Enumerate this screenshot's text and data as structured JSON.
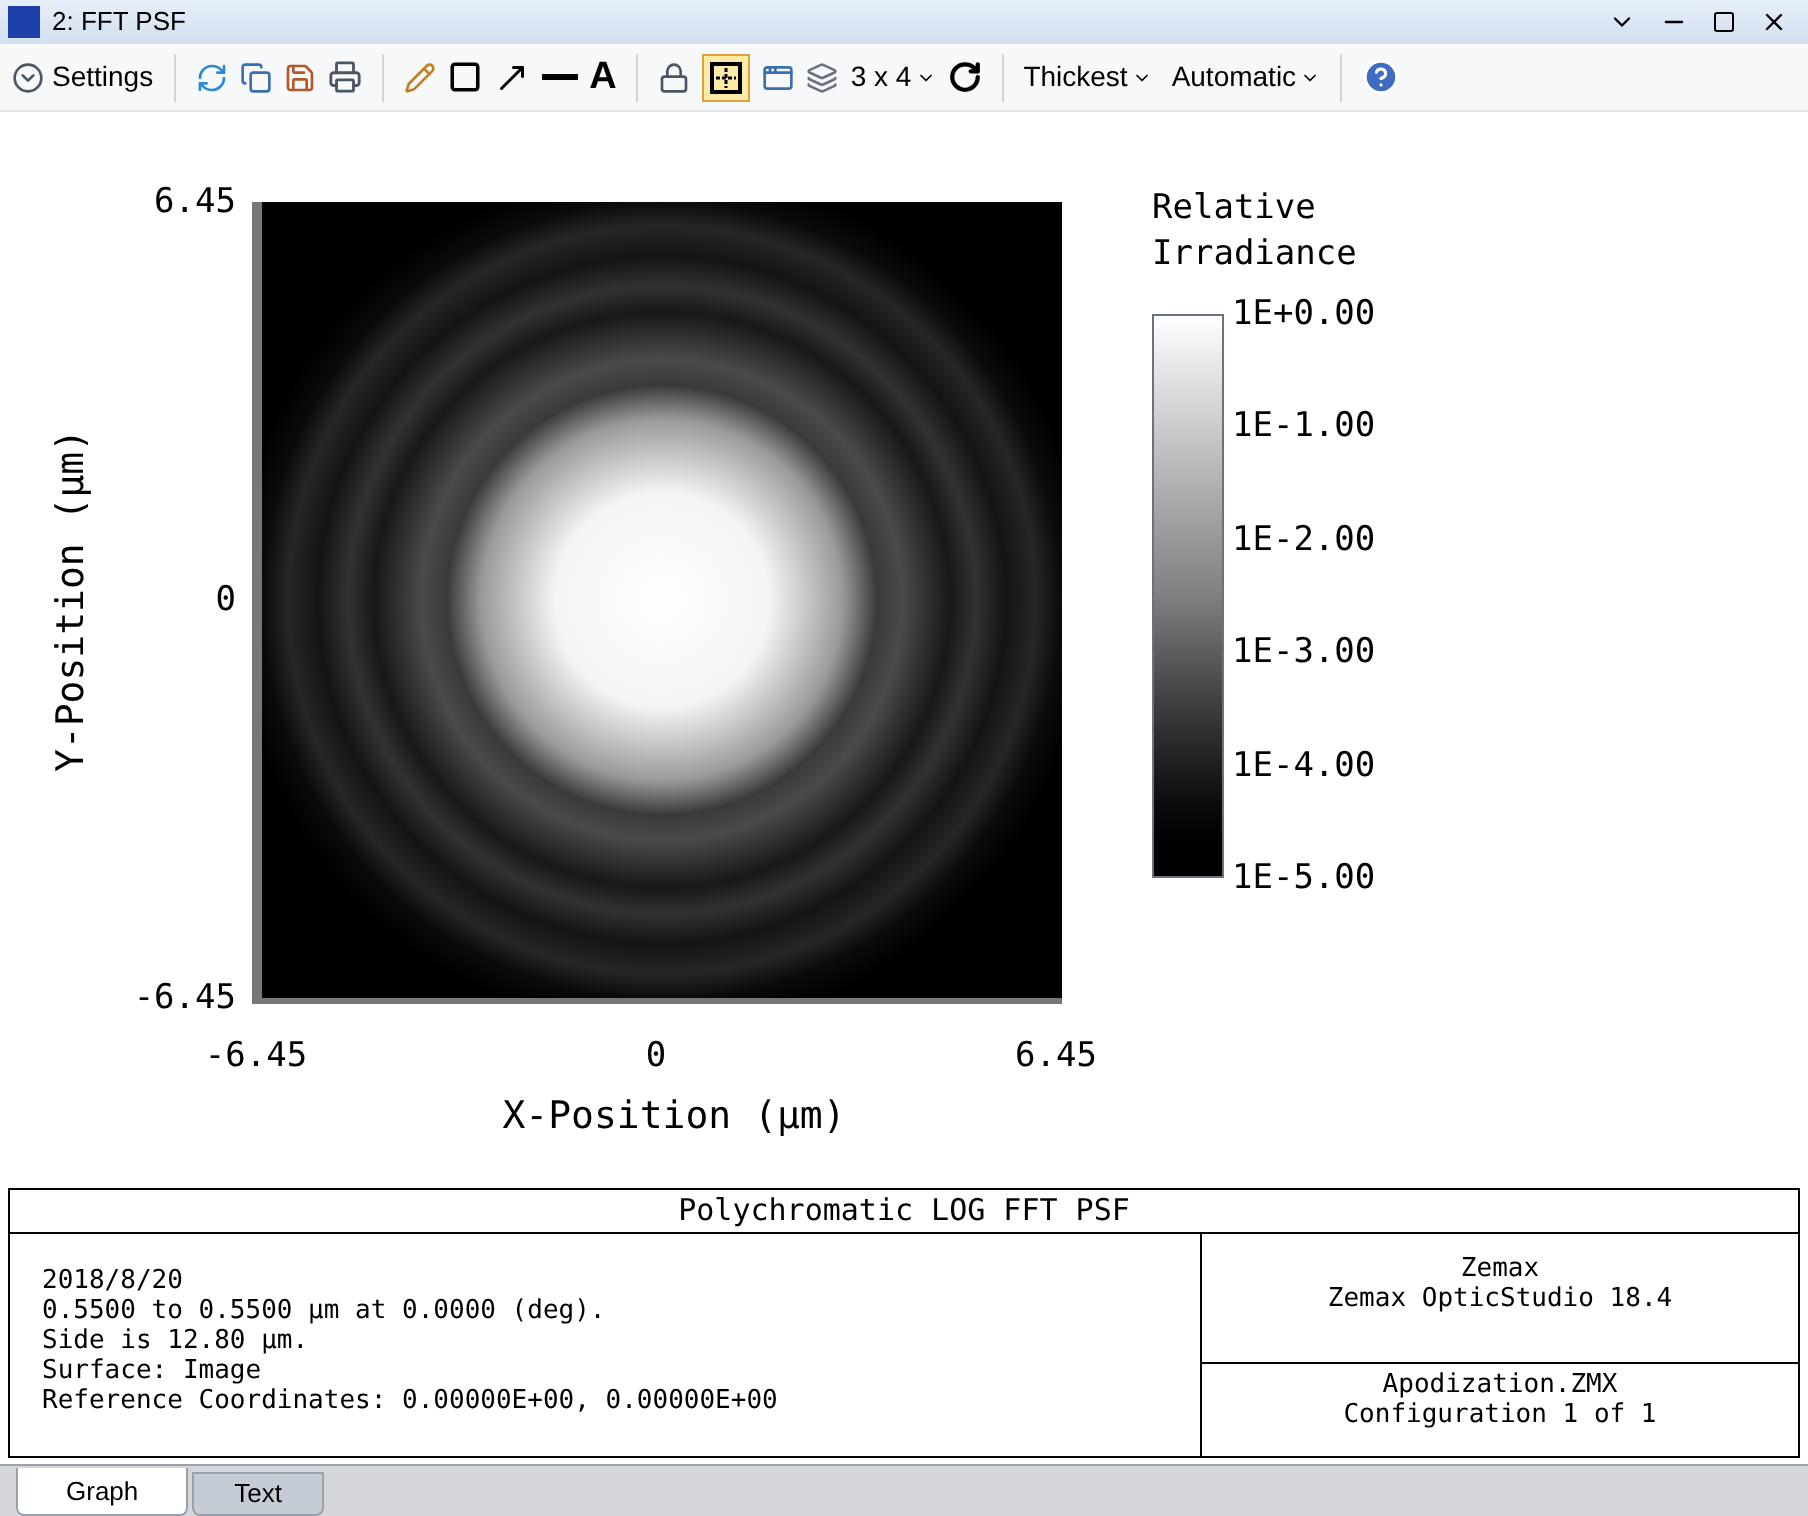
{
  "window": {
    "title": "2: FFT PSF"
  },
  "toolbar": {
    "settings": "Settings",
    "text_tool": "A",
    "layout_toggle": {
      "selected": true
    },
    "layout": "3 x 4",
    "line_width": "Thickest",
    "scale": "Automatic"
  },
  "plot": {
    "y_ticks": [
      "6.45",
      "0",
      "-6.45"
    ],
    "x_ticks": [
      "-6.45",
      "0",
      "6.45"
    ],
    "xlabel": "X-Position (µm)",
    "ylabel": "Y-Position (µm)",
    "legend_title": "Relative Irradiance",
    "legend_labels": [
      "1E+0.00",
      "1E-1.00",
      "1E-2.00",
      "1E-3.00",
      "1E-4.00",
      "1E-5.00"
    ]
  },
  "info": {
    "title": "Polychromatic LOG FFT PSF",
    "lines": [
      "2018/8/20",
      "0.5500 to 0.5500 µm at 0.0000 (deg).",
      "Side is 12.80 µm.",
      "Surface: Image",
      "Reference Coordinates: 0.00000E+00, 0.00000E+00"
    ],
    "program": [
      "Zemax",
      "Zemax OpticStudio 18.4"
    ],
    "file": [
      "Apodization.ZMX",
      "Configuration 1 of 1"
    ]
  },
  "tabs": [
    {
      "label": "Graph",
      "selected": true
    },
    {
      "label": "Text",
      "selected": false
    }
  ]
}
